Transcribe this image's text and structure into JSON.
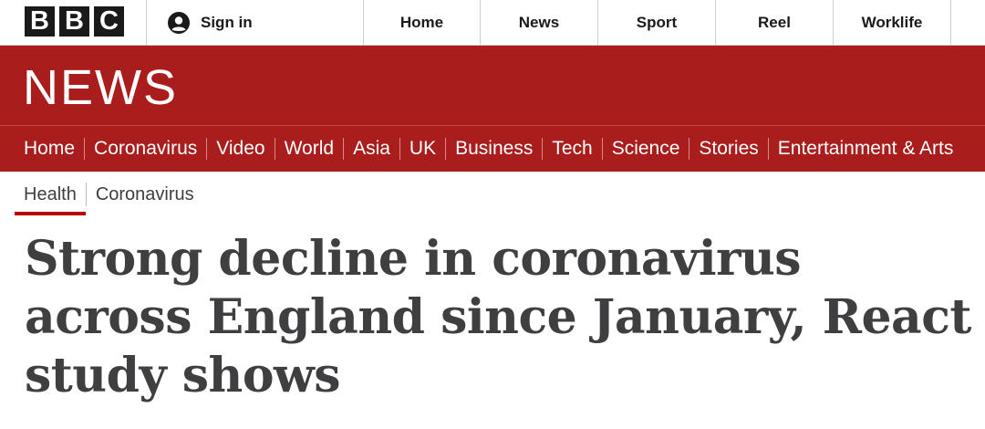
{
  "masthead": {
    "logo_letters": [
      "B",
      "B",
      "C"
    ],
    "signin_label": "Sign in",
    "signin_icon": "user-icon",
    "nav": [
      "Home",
      "News",
      "Sport",
      "Reel",
      "Worklife"
    ]
  },
  "news_band": {
    "title": "NEWS",
    "sections": [
      "Home",
      "Coronavirus",
      "Video",
      "World",
      "Asia",
      "UK",
      "Business",
      "Tech",
      "Science",
      "Stories",
      "Entertainment & Arts"
    ]
  },
  "breadcrumb": {
    "items": [
      "Health",
      "Coronavirus"
    ],
    "active": "Health"
  },
  "article": {
    "headline": "Strong decline in coronavirus across England since January, React study shows"
  },
  "colors": {
    "news_red": "#a91d1d",
    "accent_underline": "#b80000",
    "text_dark": "#3f3f42"
  }
}
